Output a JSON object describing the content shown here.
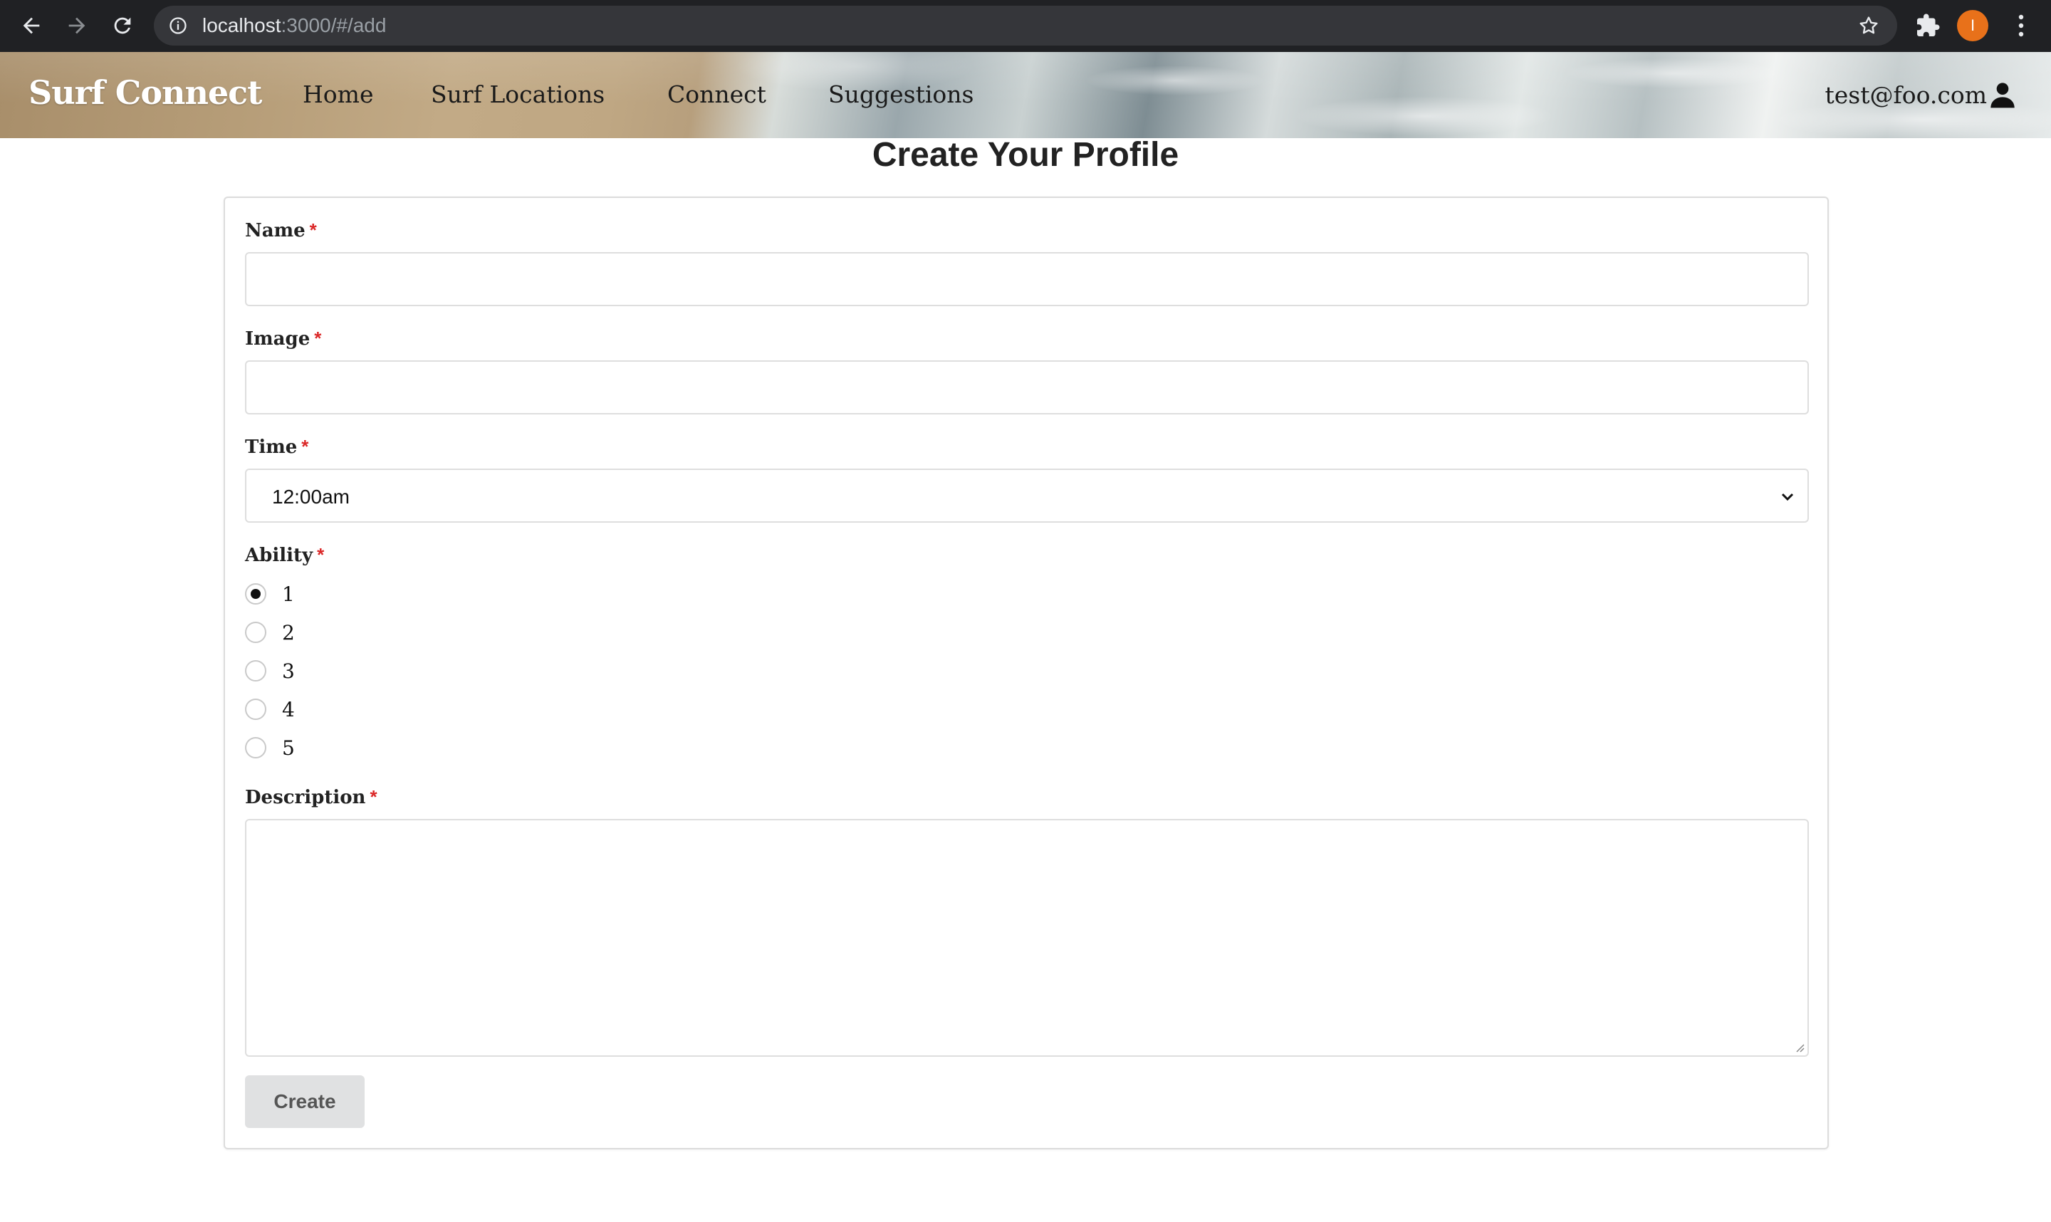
{
  "browser": {
    "url_host": "localhost",
    "url_path": ":3000/#/add",
    "profile_initial": "I",
    "accent_profile": "#e8711a"
  },
  "header": {
    "brand": "Surf Connect",
    "nav": [
      "Home",
      "Surf Locations",
      "Connect",
      "Suggestions"
    ],
    "user_email": "test@foo.com"
  },
  "page": {
    "title": "Create Your Profile"
  },
  "form": {
    "required_mark": "*",
    "name": {
      "label": "Name",
      "value": ""
    },
    "image": {
      "label": "Image",
      "value": ""
    },
    "time": {
      "label": "Time",
      "selected": "12:00am"
    },
    "ability": {
      "label": "Ability",
      "options": [
        "1",
        "2",
        "3",
        "4",
        "5"
      ],
      "selected": "1"
    },
    "description": {
      "label": "Description",
      "value": ""
    },
    "submit_label": "Create"
  },
  "icons": {
    "back": "back-arrow-icon",
    "forward": "forward-arrow-icon",
    "reload": "reload-icon",
    "info": "info-icon",
    "star": "bookmark-star-icon",
    "extensions": "puzzle-icon",
    "menu": "kebab-menu-icon",
    "user": "user-icon",
    "select": "chevron-down-icon"
  },
  "colors": {
    "required": "#db2828",
    "button_bg": "#e0e1e2",
    "chrome_bg": "#202124"
  }
}
